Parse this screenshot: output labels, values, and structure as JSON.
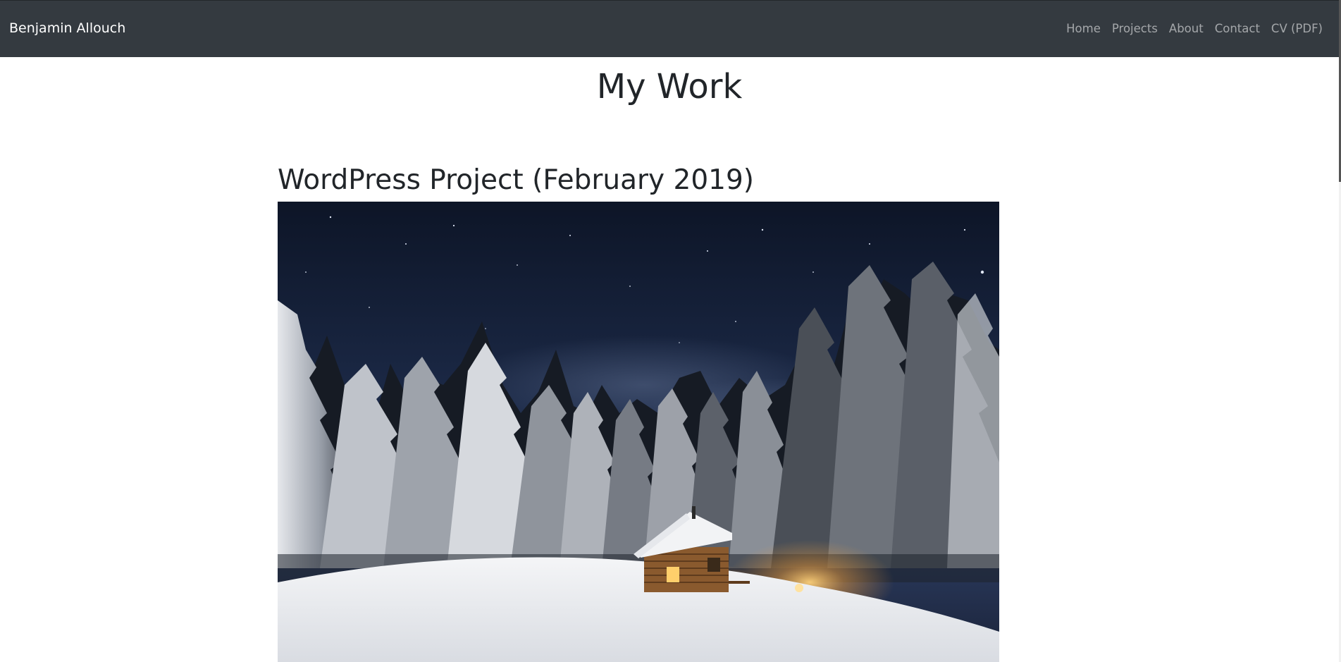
{
  "navbar": {
    "brand": "Benjamin Allouch",
    "links": [
      {
        "label": "Home"
      },
      {
        "label": "Projects"
      },
      {
        "label": "About"
      },
      {
        "label": "Contact"
      },
      {
        "label": "CV (PDF)"
      }
    ],
    "background_color": "#343a40",
    "link_color": "rgba(255,255,255,0.55)"
  },
  "main": {
    "page_title": "My Work",
    "projects": [
      {
        "title": "WordPress Project (February 2019)",
        "image_icon": "snowy-cabin-night-photo"
      }
    ]
  }
}
